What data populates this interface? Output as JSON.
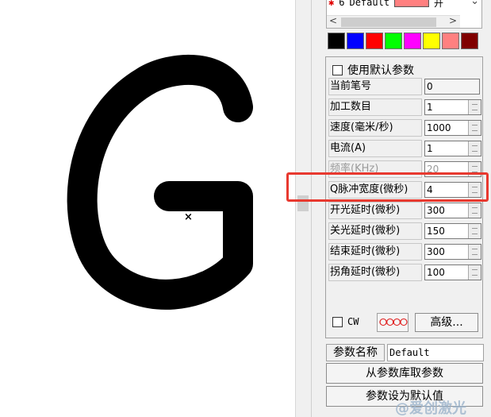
{
  "layers": {
    "row": {
      "number": "6",
      "name": "Default",
      "mode": "开"
    }
  },
  "palette": [
    "#000000",
    "#0000ff",
    "#ff0000",
    "#00ff00",
    "#ff00ff",
    "#ffff00",
    "#ff8080",
    "#800000"
  ],
  "params": {
    "use_default_label": "使用默认参数",
    "use_default_checked": false,
    "rows": [
      {
        "label": "当前笔号",
        "value": "0",
        "editable": false
      },
      {
        "label": "加工数目",
        "value": "1",
        "editable": true
      },
      {
        "label": "速度(毫米/秒)",
        "value": "1000",
        "editable": true
      },
      {
        "label": "电流(A)",
        "value": "1",
        "editable": true
      },
      {
        "label": "频率(KHz)",
        "value": "20",
        "editable": true
      },
      {
        "label": "Q脉冲宽度(微秒)",
        "value": "4",
        "editable": true
      },
      {
        "label": "开光延时(微秒)",
        "value": "300",
        "editable": true
      },
      {
        "label": "关光延时(微秒)",
        "value": "150",
        "editable": true
      },
      {
        "label": "结束延时(微秒)",
        "value": "300",
        "editable": true
      },
      {
        "label": "拐角延时(微秒)",
        "value": "100",
        "editable": true
      }
    ],
    "cw_label": "CW",
    "rings_label": "ⵔⵔⵔⵔ",
    "advanced_label": "高级...",
    "param_name_label": "参数名称",
    "param_name_value": "Default",
    "load_button": "从参数库取参数",
    "set_default_button": "参数设为默认值"
  },
  "canvas": {
    "glyph": "G",
    "center_mark": "×"
  },
  "watermark": "@爱创激光",
  "colors": {
    "highlight": "#e8392f",
    "layer_swatch": "#ff8080",
    "layer_star": "#e00000"
  }
}
